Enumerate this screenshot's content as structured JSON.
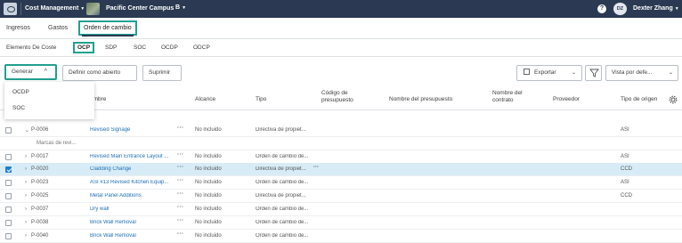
{
  "topbar": {
    "app_name": "Cost Management",
    "project": "Pacific Center Campus",
    "project_badge": "B",
    "help": "?",
    "avatar_initials": "DZ",
    "user": "Dexter Zhang"
  },
  "primary_tabs": [
    "Ingresos",
    "Gastos",
    "Orden de cambio"
  ],
  "secondary_tabs": [
    "Elemento De Coste",
    "OCP",
    "SDP",
    "SOC",
    "OCDP",
    "ODCP"
  ],
  "toolbar": {
    "generate": "Generar",
    "define_open": "Definir como abierto",
    "delete": "Suprimir",
    "export": "Exportar",
    "view": "Vista por defe..."
  },
  "dropdown": [
    "OCDP",
    "SOC"
  ],
  "columns": {
    "name": "ombre",
    "scope": "Alcance",
    "type": "Tipo",
    "budget_code": "Código de presupuesto",
    "budget_name": "Nombre del presupuesto",
    "contract_name": "Nombre del contrato",
    "supplier": "Proveedor",
    "origin_type": "Tipo de origen"
  },
  "rows": [
    {
      "id": "P-0006",
      "name": "Revised Signage",
      "scope": "No incluido",
      "type": "Directiva de propiet...",
      "origin": "ASI",
      "expanded": true,
      "checked": false
    },
    {
      "sub": "Marcas de revi..."
    },
    {
      "id": "P-0017",
      "name": "Revised Main Entrance Layout ...",
      "scope": "No incluido",
      "type": "Orden de cambio de...",
      "origin": "ASI",
      "checked": false
    },
    {
      "id": "P-0020",
      "name": "Cladding Change",
      "scope": "No incluido",
      "type": "Directiva de propiet...",
      "origin": "CCD",
      "checked": true
    },
    {
      "id": "P-0023",
      "name": "ASI #13 Revised Kitchen Equip...",
      "scope": "No incluido",
      "type": "Orden de cambio de...",
      "origin": "ASI",
      "checked": false
    },
    {
      "id": "P-0025",
      "name": "Metal Panel Additions",
      "scope": "No incluido",
      "type": "Directiva de propiet...",
      "origin": "CCD",
      "checked": false
    },
    {
      "id": "P-0037",
      "name": "Dry wall",
      "scope": "No incluido",
      "type": "Orden de cambio de...",
      "origin": "",
      "checked": false
    },
    {
      "id": "P-0038",
      "name": "Brick Wall Removal",
      "scope": "No incluido",
      "type": "Orden de cambio de...",
      "origin": "",
      "checked": false
    },
    {
      "id": "P-0040",
      "name": "Brick Wall Removal",
      "scope": "No incluido",
      "type": "Orden de cambio de...",
      "origin": "",
      "checked": false
    }
  ],
  "colors": {
    "topbar": "#2b3a52",
    "highlight": "#21a08e",
    "link": "#1f6fb5",
    "selected_row": "#d7ecf6"
  }
}
